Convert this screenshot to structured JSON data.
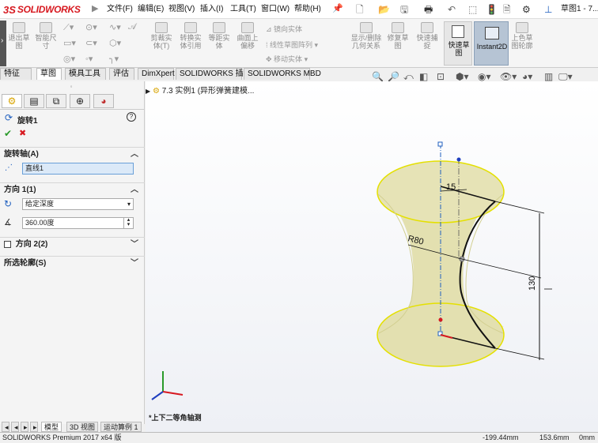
{
  "app": {
    "brand_ds": "3S",
    "brand_name": "SOLIDWORKS",
    "doc_title": "草图1 - 7..."
  },
  "menu": [
    "文件(F)",
    "编辑(E)",
    "视图(V)",
    "插入(I)",
    "工具(T)",
    "窗口(W)",
    "帮助(H)"
  ],
  "commands": {
    "exit_sketch": "退出草图",
    "smart_dim": "智能尺寸",
    "trim": "剪裁实体(T)",
    "convert": "转换实体引用",
    "offset": "等距实体",
    "surface_offset": "曲面上偏移",
    "mirror": "镜向实体",
    "linear_pattern": "线性草图阵列",
    "move": "移动实体",
    "show_relations": "显示/删除几何关系",
    "repair": "修复草图",
    "quick_snap": "快速捕捉",
    "quick_sketch": "快速草图",
    "instant2d": "Instant2D",
    "shaded_sketch": "上色草图轮廓"
  },
  "tabs": [
    "特征",
    "草图",
    "模具工具",
    "评估",
    "DimXpert",
    "SOLIDWORKS 插件",
    "SOLIDWORKS MBD"
  ],
  "tree": {
    "root": "7.3 实例1 (异形弹簧建模..."
  },
  "pm": {
    "feature_title": "旋转1",
    "ok": "✔",
    "cancel": "✖",
    "help": "?",
    "axis_section": "旋转轴(A)",
    "axis_value": "直线1",
    "dir1_section": "方向 1(1)",
    "end_condition": "给定深度",
    "angle_value": "360.00度",
    "dir2_section": "方向 2(2)",
    "contours_section": "所选轮廓(S)"
  },
  "view": {
    "orientation_label": "*上下二等角轴测"
  },
  "dims": {
    "d15": "15",
    "r80": "R80",
    "d130": "130"
  },
  "bottom_tabs": [
    "模型",
    "3D 视图",
    "运动算例 1"
  ],
  "status": {
    "product": "SOLIDWORKS Premium 2017 x64 版",
    "x": "-199.44mm",
    "y": "153.6mm",
    "z": "0mm"
  },
  "colors": {
    "accent": "#d71920",
    "surface": "#e3e0b0",
    "rim": "#e4e000",
    "selected": "#1f5fbf"
  }
}
